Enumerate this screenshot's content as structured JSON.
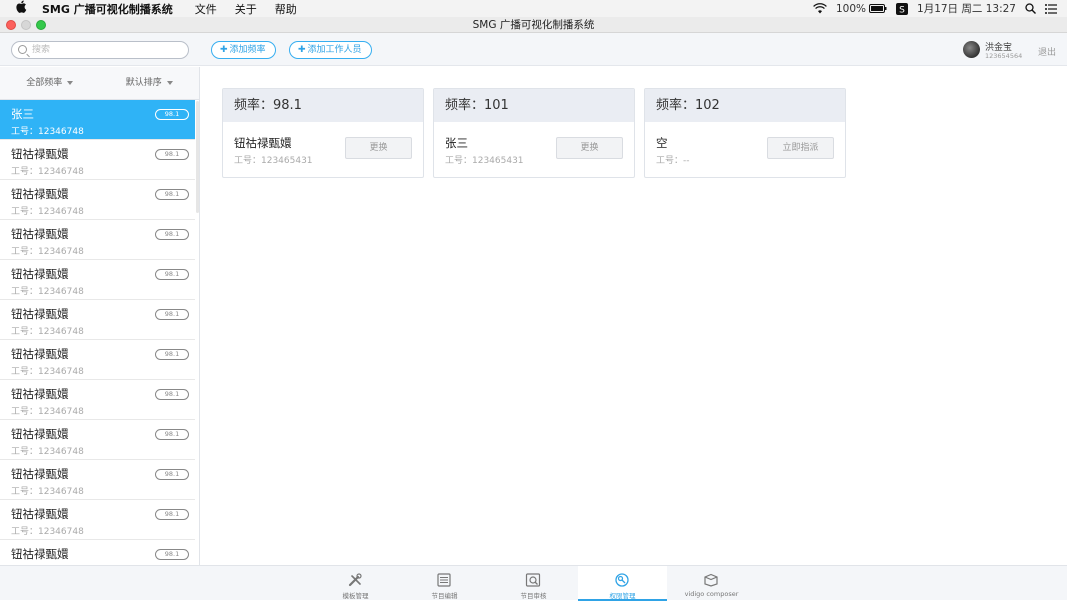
{
  "menubar": {
    "app_name": "SMG 广播可视化制播系统",
    "items": [
      "文件",
      "关于",
      "帮助"
    ],
    "battery": "100%",
    "clock": "1月17日 周二  13:27"
  },
  "window": {
    "title": "SMG 广播可视化制播系统"
  },
  "toolbar": {
    "search_placeholder": "搜索",
    "add_frequency": "添加频率",
    "add_staff": "添加工作人员",
    "user_name": "洪金宝",
    "user_id": "123654564",
    "logout": "退出"
  },
  "sidebar": {
    "filter_all": "全部频率",
    "filter_sort": "默认排序",
    "items": [
      {
        "name": "张三",
        "id": "工号：12346748",
        "tag": "98.1",
        "active": true
      },
      {
        "name": "钮祜禄甄嬛",
        "id": "工号：12346748",
        "tag": "98.1"
      },
      {
        "name": "钮祜禄甄嬛",
        "id": "工号：12346748",
        "tag": "98.1"
      },
      {
        "name": "钮祜禄甄嬛",
        "id": "工号：12346748",
        "tag": "98.1"
      },
      {
        "name": "钮祜禄甄嬛",
        "id": "工号：12346748",
        "tag": "98.1"
      },
      {
        "name": "钮祜禄甄嬛",
        "id": "工号：12346748",
        "tag": "98.1"
      },
      {
        "name": "钮祜禄甄嬛",
        "id": "工号：12346748",
        "tag": "98.1"
      },
      {
        "name": "钮祜禄甄嬛",
        "id": "工号：12346748",
        "tag": "98.1"
      },
      {
        "name": "钮祜禄甄嬛",
        "id": "工号：12346748",
        "tag": "98.1"
      },
      {
        "name": "钮祜禄甄嬛",
        "id": "工号：12346748",
        "tag": "98.1"
      },
      {
        "name": "钮祜禄甄嬛",
        "id": "工号：12346748",
        "tag": "98.1"
      },
      {
        "name": "钮祜禄甄嬛",
        "id": "工号：12346748",
        "tag": "98.1"
      }
    ]
  },
  "cards": [
    {
      "title": "频率：98.1",
      "name": "钮祜禄甄嬛",
      "sub": "工号：123465431",
      "button": "更换"
    },
    {
      "title": "频率：101",
      "name": "张三",
      "sub": "工号：123465431",
      "button": "更换"
    },
    {
      "title": "频率：102",
      "name": "空",
      "sub": "工号：--",
      "button": "立即指派"
    }
  ],
  "bottom_tabs": [
    {
      "label": "模板管理",
      "icon": "template-tools-icon"
    },
    {
      "label": "节目编辑",
      "icon": "program-edit-icon"
    },
    {
      "label": "节目审核",
      "icon": "program-review-icon"
    },
    {
      "label": "权限管理",
      "icon": "permission-icon",
      "active": true
    },
    {
      "label": "vidigo composer",
      "icon": "composer-box-icon"
    }
  ],
  "colors": {
    "accent": "#2fb3f6",
    "accent_text": "#2fa3e6",
    "traffic_red": "#fc605c",
    "traffic_yellow": "#d7d7d7",
    "traffic_green": "#34c84a"
  }
}
